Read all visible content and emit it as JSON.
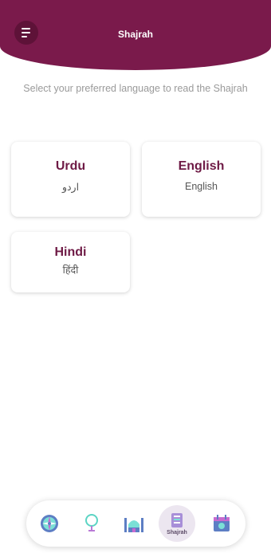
{
  "header": {
    "title": "Shajrah",
    "menu_icon": "menu-icon",
    "background_color": "#7a1a4b"
  },
  "instruction": "Select your preferred language to read the Shajrah",
  "languages": [
    {
      "name": "Urdu",
      "native": "اردو"
    },
    {
      "name": "English",
      "native": "English"
    },
    {
      "name": "Hindi",
      "native": "हिंदी"
    }
  ],
  "bottom_nav": {
    "items": [
      {
        "icon": "compass-icon",
        "label": ""
      },
      {
        "icon": "lamp-icon",
        "label": ""
      },
      {
        "icon": "mosque-icon",
        "label": ""
      },
      {
        "icon": "shajrah-book-icon",
        "label": "Shajrah",
        "active": true
      },
      {
        "icon": "calendar-icon",
        "label": ""
      }
    ]
  }
}
